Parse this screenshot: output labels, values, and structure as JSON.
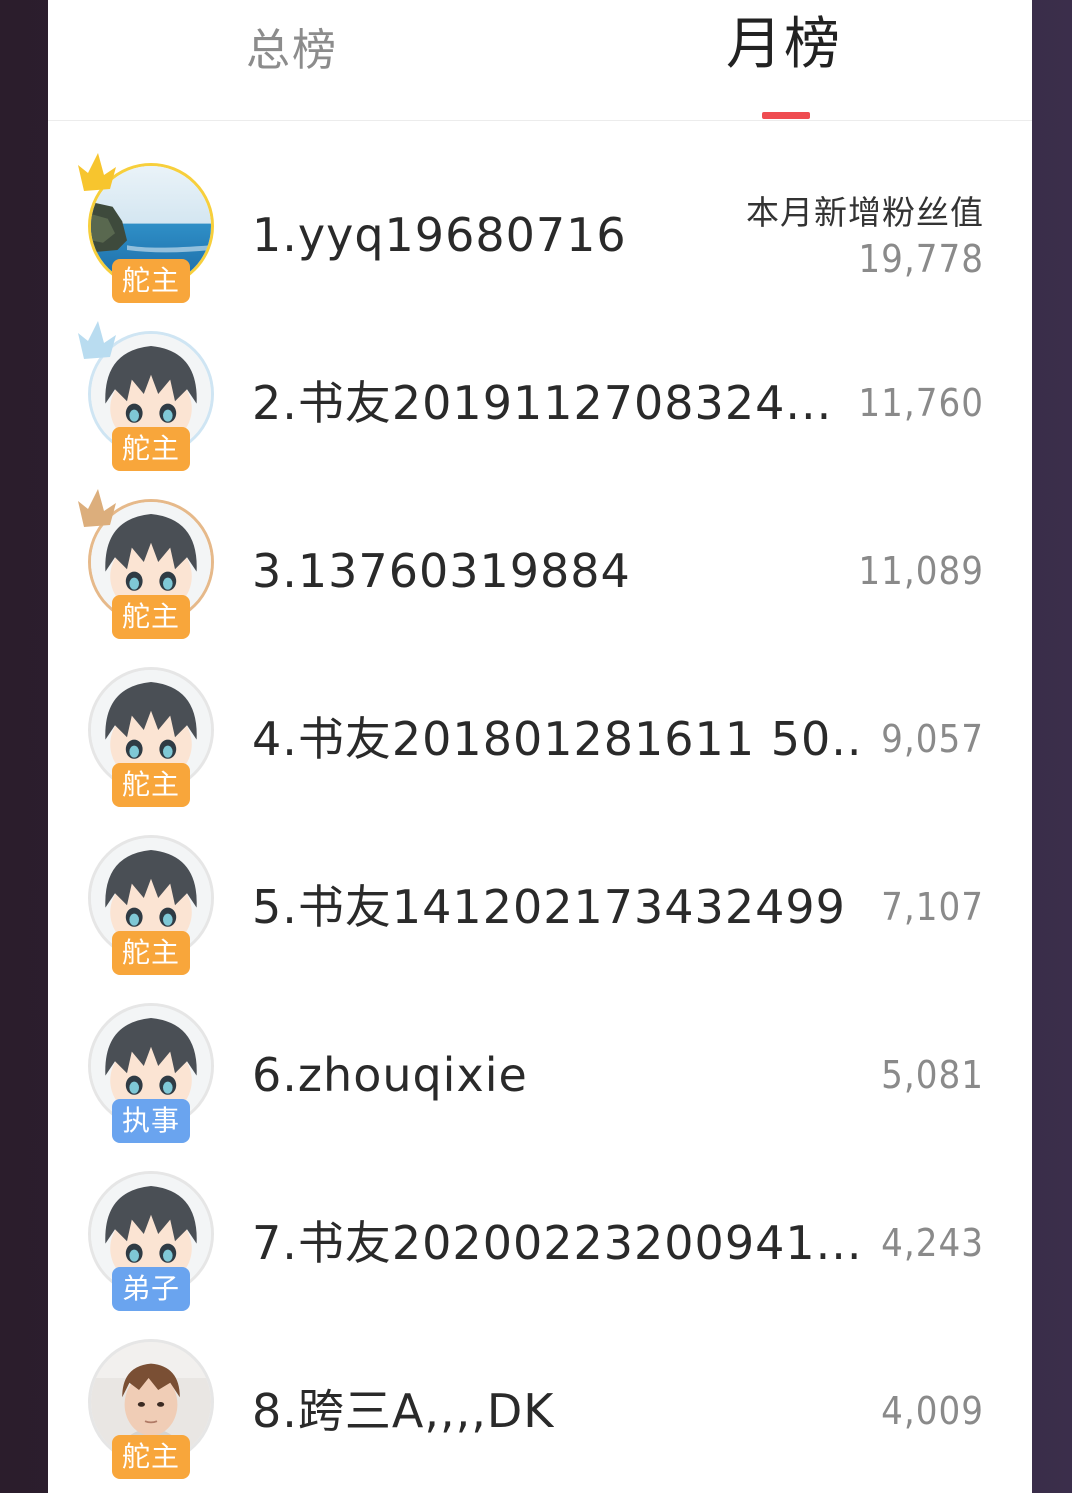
{
  "tabs": [
    {
      "label": "总榜",
      "active": false
    },
    {
      "label": "月榜",
      "active": true
    }
  ],
  "header_note": "本月新增粉丝值",
  "colors": {
    "accent": "#ef4b50",
    "badge_orange": "#f8a63b",
    "badge_blue": "#6aa4ef"
  },
  "rankings": [
    {
      "name": "1.yyq19680716",
      "value": "19,778",
      "role": "舵主",
      "avatar": "landscape",
      "crown": "gold"
    },
    {
      "name": "2.书友2019112708324...",
      "value": "11,760",
      "role": "舵主",
      "avatar": "anime",
      "crown": "silver"
    },
    {
      "name": "3.13760319884",
      "value": "11,089",
      "role": "舵主",
      "avatar": "anime",
      "crown": "bronze"
    },
    {
      "name": "4.书友201801281611 50...",
      "value": "9,057",
      "role": "舵主",
      "avatar": "anime"
    },
    {
      "name": "5.书友141202173432499",
      "value": "7,107",
      "role": "舵主",
      "avatar": "anime"
    },
    {
      "name": "6.zhouqixie",
      "value": "5,081",
      "role": "执事",
      "avatar": "anime"
    },
    {
      "name": "7.书友20200223200941...",
      "value": "4,243",
      "role": "弟子",
      "avatar": "anime"
    },
    {
      "name": "8.跨三A,,,,DK",
      "value": "4,009",
      "role": "舵主",
      "avatar": "photo"
    }
  ]
}
